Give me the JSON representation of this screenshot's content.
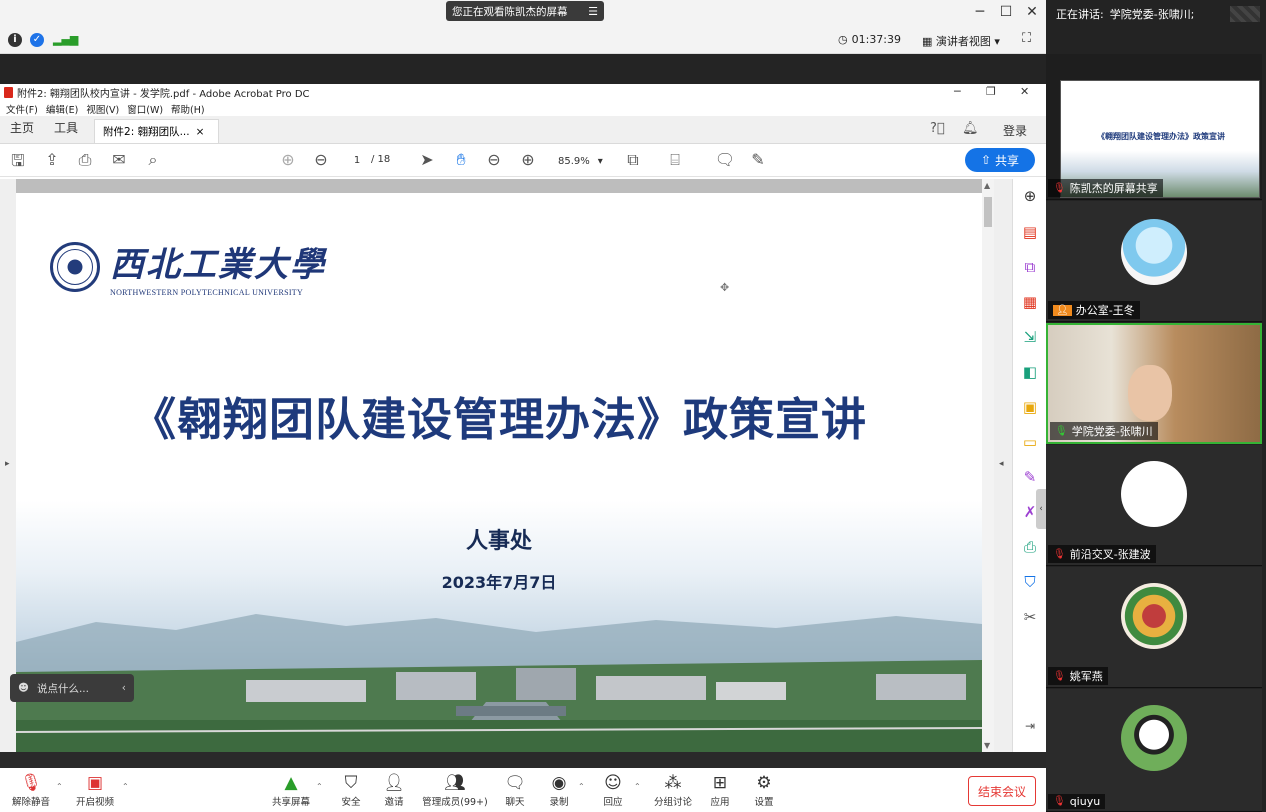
{
  "meeting": {
    "watching": "您正在观看陈凯杰的屏幕",
    "timer": "01:37:39",
    "view_mode": "演讲者视图",
    "speaking_label": "正在讲话:",
    "speaking_name": "学院党委-张啸川;"
  },
  "acrobat": {
    "window_title": "附件2:  翱翔团队校内宣讲 - 发学院.pdf - Adobe Acrobat Pro DC",
    "menu": [
      "文件(F)",
      "编辑(E)",
      "视图(V)",
      "窗口(W)",
      "帮助(H)"
    ],
    "tabs": {
      "home": "主页",
      "tools": "工具",
      "doc": "附件2:   翱翔团队..."
    },
    "login": "登录",
    "page_current": "1",
    "page_total": "/ 18",
    "zoom": "85.9%",
    "share": "共享"
  },
  "slide": {
    "uni_cn": "西北工業大學",
    "uni_en": "NORTHWESTERN POLYTECHNICAL UNIVERSITY",
    "title": "《翱翔团队建设管理办法》政策宣讲",
    "dept": "人事处",
    "date": "2023年7月7日"
  },
  "chat": {
    "placeholder": "说点什么..."
  },
  "toolbar": {
    "unmute": "解除静音",
    "video": "开启视频",
    "share_screen": "共享屏幕",
    "security": "安全",
    "invite": "邀请",
    "members": "管理成员(99+)",
    "chat": "聊天",
    "record": "录制",
    "reaction": "回应",
    "breakout": "分组讨论",
    "apps": "应用",
    "settings": "设置",
    "end": "结束会议"
  },
  "participants": [
    {
      "name": "陈凯杰的屏幕共享"
    },
    {
      "name": "办公室-王冬"
    },
    {
      "name": "学院党委-张啸川"
    },
    {
      "name": "前沿交叉-张建波"
    },
    {
      "name": "姚军燕"
    },
    {
      "name": "qiuyu"
    }
  ],
  "thumb_title": "《翱翔团队建设管理办法》政策宣讲",
  "colors": {
    "accent": "#1473e6",
    "title": "#1e3a7c",
    "end": "#e53935"
  }
}
